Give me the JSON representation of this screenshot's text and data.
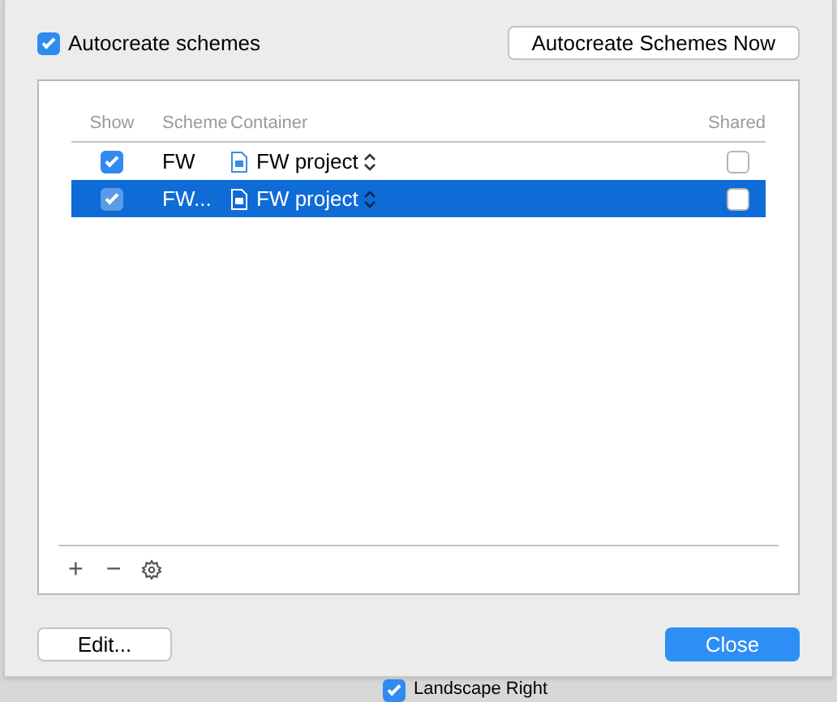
{
  "autocreate": {
    "label": "Autocreate schemes",
    "checked": true
  },
  "autocreate_now_button": "Autocreate Schemes Now",
  "table": {
    "columns": [
      "Show",
      "Scheme",
      "Container",
      "Shared"
    ],
    "rows": [
      {
        "show": true,
        "scheme": "FW",
        "container": "FW project",
        "shared": false,
        "selected": false
      },
      {
        "show": true,
        "scheme": "FW...",
        "container": "FW project",
        "shared": false,
        "selected": true
      }
    ]
  },
  "toolbar": [
    "+",
    "−"
  ],
  "buttons": {
    "edit": "Edit...",
    "close": "Close"
  },
  "background": {
    "checkbox": {
      "label": "Landscape Right",
      "checked": true
    }
  }
}
